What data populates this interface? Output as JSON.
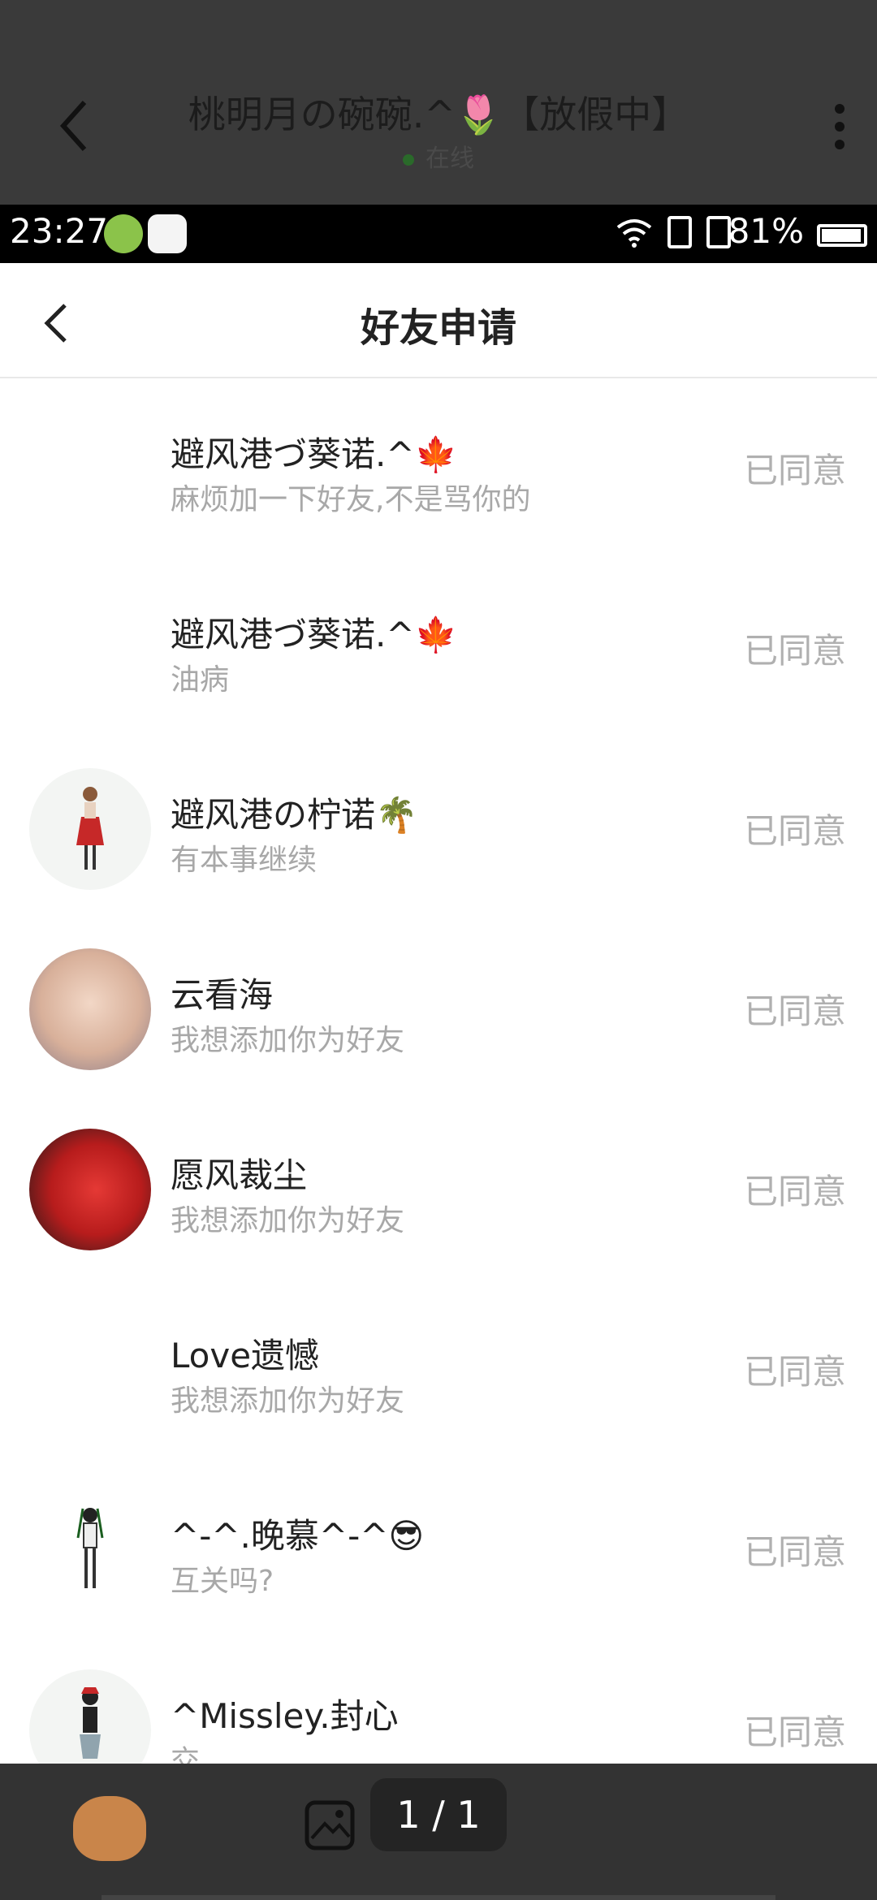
{
  "background_chat": {
    "title": "桃明月の碗碗.^🌷【放假中】",
    "presence": "在线"
  },
  "status_bar": {
    "time": "23:27",
    "battery_percent": "81%"
  },
  "header": {
    "title": "好友申请"
  },
  "requests": [
    {
      "name": "避风港づ葵诺.^🍁",
      "message": "麻烦加一下好友,不是骂你的",
      "state": "已同意"
    },
    {
      "name": "避风港づ葵诺.^🍁",
      "message": "油病",
      "state": "已同意"
    },
    {
      "name": "避风港の柠诺🌴",
      "message": "有本事继续",
      "state": "已同意"
    },
    {
      "name": "云看海",
      "message": "我想添加你为好友",
      "state": "已同意"
    },
    {
      "name": "愿风裁尘",
      "message": "我想添加你为好友",
      "state": "已同意"
    },
    {
      "name": "Love遗憾",
      "message": "我想添加你为好友",
      "state": "已同意"
    },
    {
      "name": "^-^.晚慕^-^😎",
      "message": "互关吗?",
      "state": "已同意"
    },
    {
      "name": "^Missley.封心",
      "message": "交",
      "state": "已同意"
    }
  ],
  "bottom_bar": {
    "pager": "1 / 1"
  },
  "colors": {
    "accept_state": "#b0b0b0",
    "message": "#a8a8a8",
    "bottom_bar": "#333333"
  }
}
